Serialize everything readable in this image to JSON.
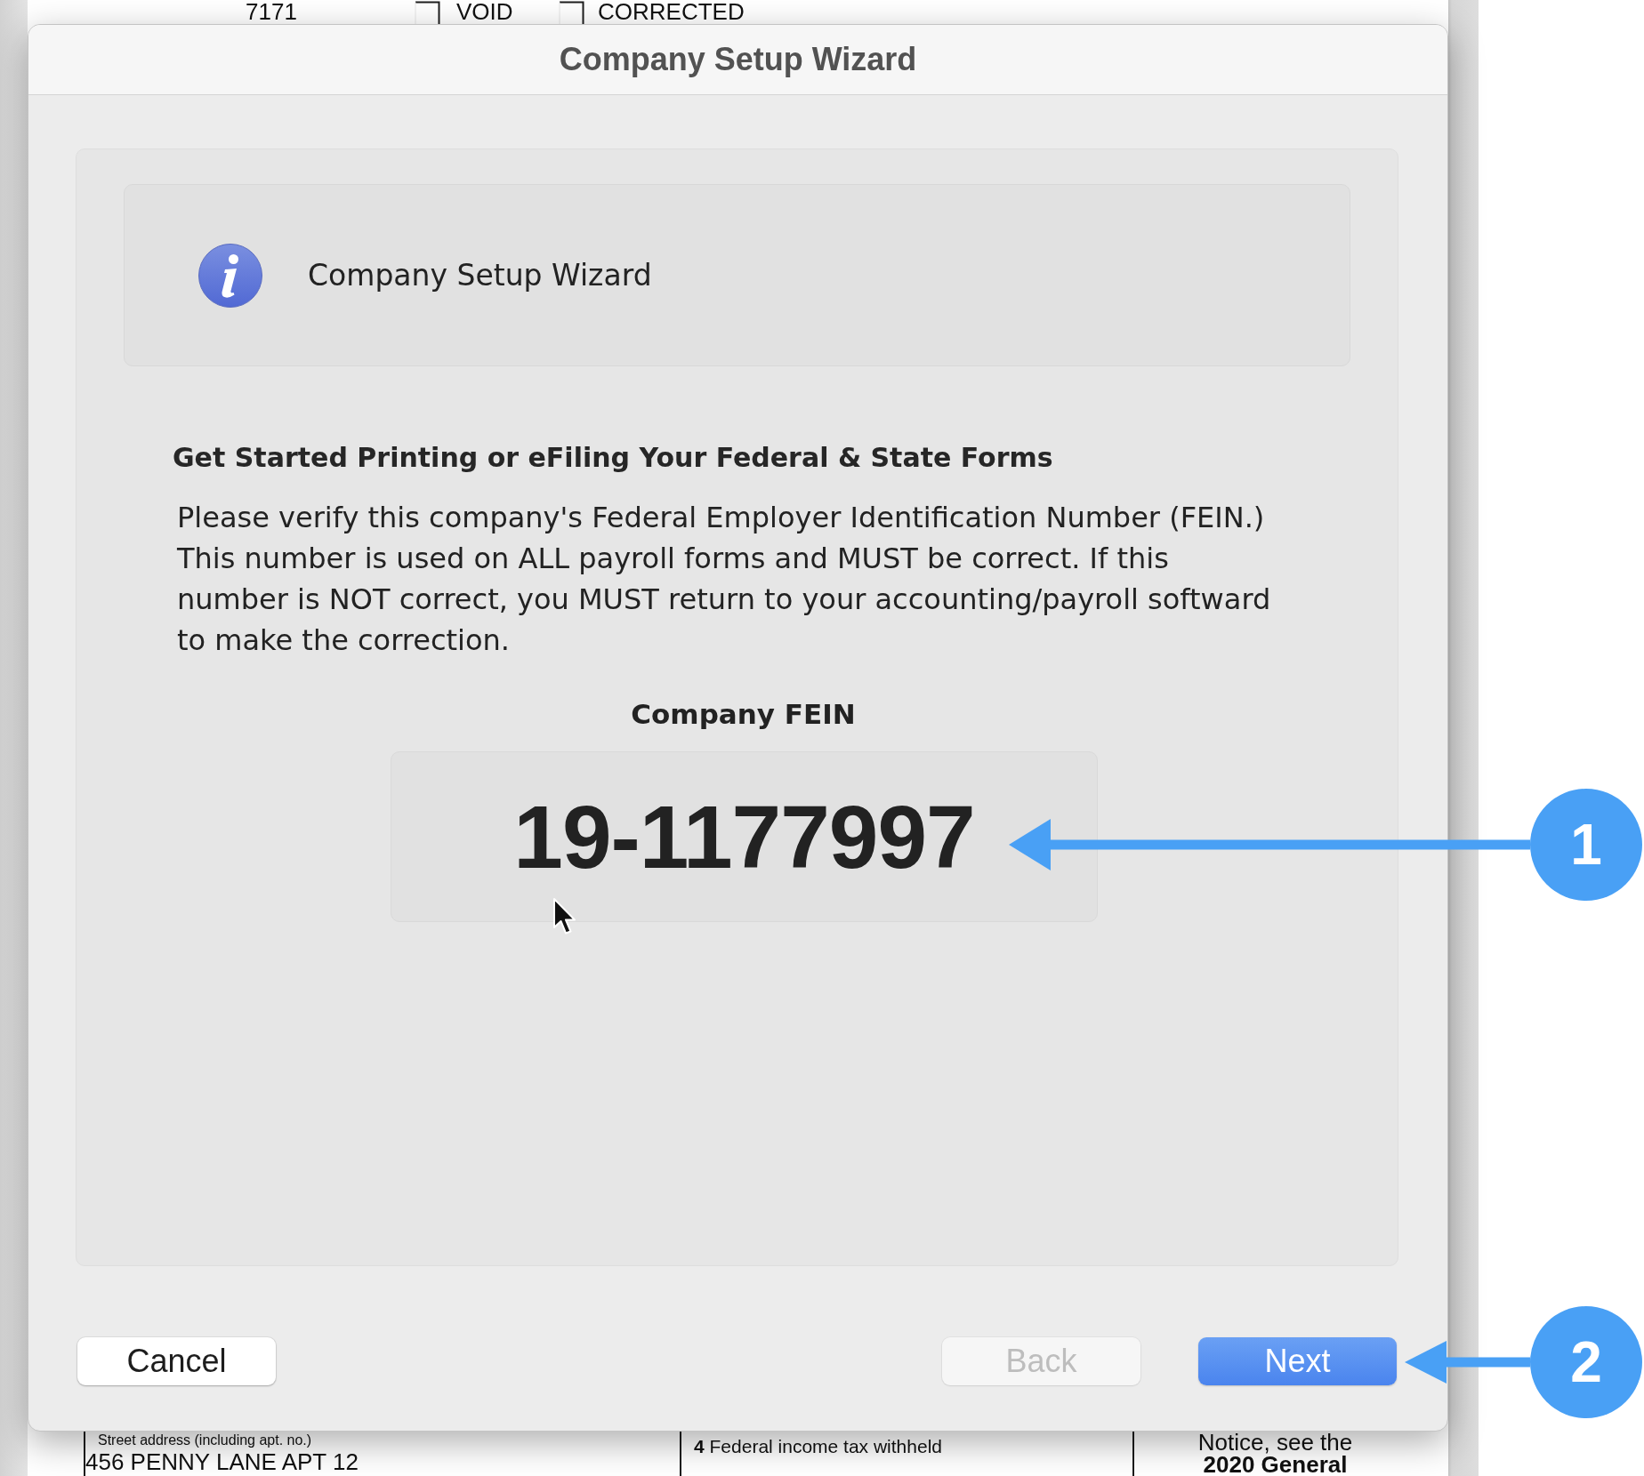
{
  "background_form": {
    "top": {
      "number": "7171",
      "checkboxes": [
        {
          "label": "VOID",
          "checked": false
        },
        {
          "label": "CORRECTED",
          "checked": false
        }
      ]
    },
    "bottom": {
      "street_address_label": "Street address (including apt. no.)",
      "street_address": "456 PENNY LANE APT 12",
      "box_4_label": "**4** Federal income tax withheld",
      "notice_text": "Notice, see the",
      "notice_bold": "2020 General"
    }
  },
  "dialog": {
    "title": "Company Setup Wizard",
    "banner_text": "Company Setup Wizard",
    "heading": "Get Started Printing or eFiling Your Federal & State Forms",
    "paragraph": "Please verify this company's Federal Employer Identification Number (FEIN.)\nThis number is used on ALL payroll forms and MUST be correct. If this\nnumber is NOT correct, you MUST return to your accounting/payroll softward\nto make the correction.",
    "fein_label": "Company FEIN",
    "fein": "19-1177997",
    "buttons": [
      {
        "label": "Cancel",
        "kind": "default",
        "disabled": false
      },
      {
        "label": "Back",
        "kind": "default",
        "disabled": true
      },
      {
        "label": "Next",
        "kind": "primary",
        "disabled": false
      }
    ]
  },
  "annotations": [
    {
      "number": "1"
    },
    {
      "number": "2"
    }
  ]
}
